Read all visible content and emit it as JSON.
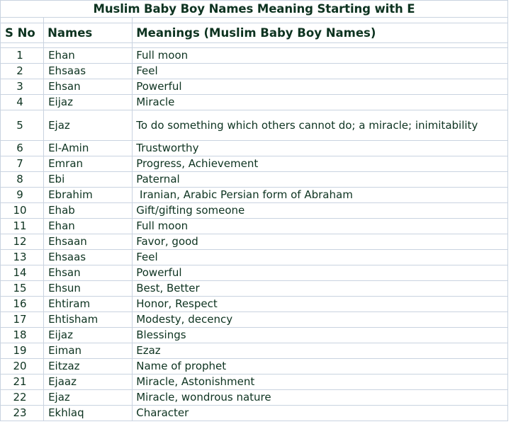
{
  "document": {
    "title": "Muslim Baby Boy Names Meaning Starting with E",
    "text_color": "#0d3320",
    "grid_color": "#c9d3e0",
    "background": "#ffffff"
  },
  "table": {
    "columns": [
      {
        "key": "sno",
        "label": "S No"
      },
      {
        "key": "name",
        "label": "Names"
      },
      {
        "key": "meaning",
        "label": "Meanings (Muslim Baby Boy Names)"
      }
    ],
    "rows": [
      {
        "sno": "1",
        "name": "Ehan",
        "meaning": "Full moon"
      },
      {
        "sno": "2",
        "name": "Ehsaas",
        "meaning": "Feel"
      },
      {
        "sno": "3",
        "name": "Ehsan",
        "meaning": "Powerful"
      },
      {
        "sno": "4",
        "name": "Eijaz",
        "meaning": "Miracle"
      },
      {
        "sno": "5",
        "name": "Ejaz",
        "meaning": "To do something which others cannot do; a miracle; inimitability",
        "tall": true
      },
      {
        "sno": "6",
        "name": "El-Amin",
        "meaning": "Trustworthy"
      },
      {
        "sno": "7",
        "name": "Emran",
        "meaning": "Progress, Achievement"
      },
      {
        "sno": "8",
        "name": "Ebi",
        "meaning": "Paternal"
      },
      {
        "sno": "9",
        "name": "Ebrahim",
        "meaning": " Iranian, Arabic Persian form of Abraham"
      },
      {
        "sno": "10",
        "name": "Ehab",
        "meaning": "Gift/gifting someone"
      },
      {
        "sno": "11",
        "name": "Ehan",
        "meaning": "Full moon"
      },
      {
        "sno": "12",
        "name": "Ehsaan",
        "meaning": "Favor, good"
      },
      {
        "sno": "13",
        "name": "Ehsaas",
        "meaning": "Feel"
      },
      {
        "sno": "14",
        "name": "Ehsan",
        "meaning": "Powerful"
      },
      {
        "sno": "15",
        "name": "Ehsun",
        "meaning": "Best, Better"
      },
      {
        "sno": "16",
        "name": "Ehtiram",
        "meaning": "Honor, Respect"
      },
      {
        "sno": "17",
        "name": "Ehtisham",
        "meaning": "Modesty, decency"
      },
      {
        "sno": "18",
        "name": "Eijaz",
        "meaning": "Blessings"
      },
      {
        "sno": "19",
        "name": "Eiman",
        "meaning": "Ezaz"
      },
      {
        "sno": "20",
        "name": "Eitzaz",
        "meaning": "Name of prophet"
      },
      {
        "sno": "21",
        "name": "Ejaaz",
        "meaning": "Miracle, Astonishment"
      },
      {
        "sno": "22",
        "name": "Ejaz",
        "meaning": "Miracle, wondrous nature"
      },
      {
        "sno": "23",
        "name": "Ekhlaq",
        "meaning": "Character"
      }
    ]
  }
}
